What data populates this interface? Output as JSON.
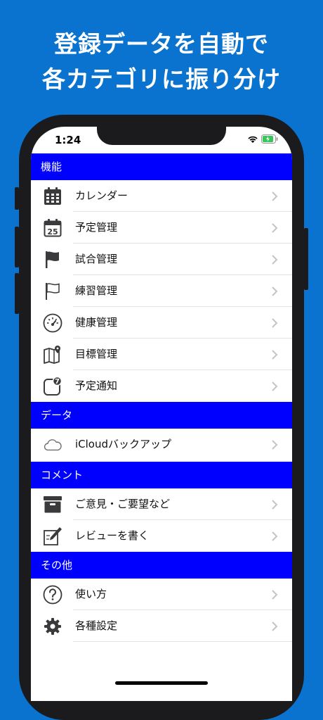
{
  "headline": {
    "line1": "登録データを自動で",
    "line2": "各カテゴリに振り分け"
  },
  "status": {
    "time": "1:24"
  },
  "sections": {
    "features": {
      "title": "機能",
      "items": [
        {
          "label": "カレンダー",
          "icon": "calendar-grid-icon"
        },
        {
          "label": "予定管理",
          "icon": "calendar-25-icon",
          "icon_text": "25"
        },
        {
          "label": "試合管理",
          "icon": "flag-filled-icon"
        },
        {
          "label": "練習管理",
          "icon": "flag-outline-icon"
        },
        {
          "label": "健康管理",
          "icon": "gauge-icon"
        },
        {
          "label": "目標管理",
          "icon": "map-pin-icon"
        },
        {
          "label": "予定通知",
          "icon": "notification-badge-icon",
          "icon_text": "7"
        }
      ]
    },
    "data": {
      "title": "データ",
      "items": [
        {
          "label": "iCloudバックアップ",
          "icon": "cloud-icon"
        }
      ]
    },
    "comment": {
      "title": "コメント",
      "items": [
        {
          "label": "ご意見・ご要望など",
          "icon": "inbox-tray-icon"
        },
        {
          "label": "レビューを書く",
          "icon": "write-review-icon"
        }
      ]
    },
    "other": {
      "title": "その他",
      "items": [
        {
          "label": "使い方",
          "icon": "question-circle-icon"
        },
        {
          "label": "各種設定",
          "icon": "gear-icon"
        }
      ]
    }
  },
  "colors": {
    "background": "#0a73cf",
    "section_header": "#0000ff",
    "battery": "#34c759"
  }
}
